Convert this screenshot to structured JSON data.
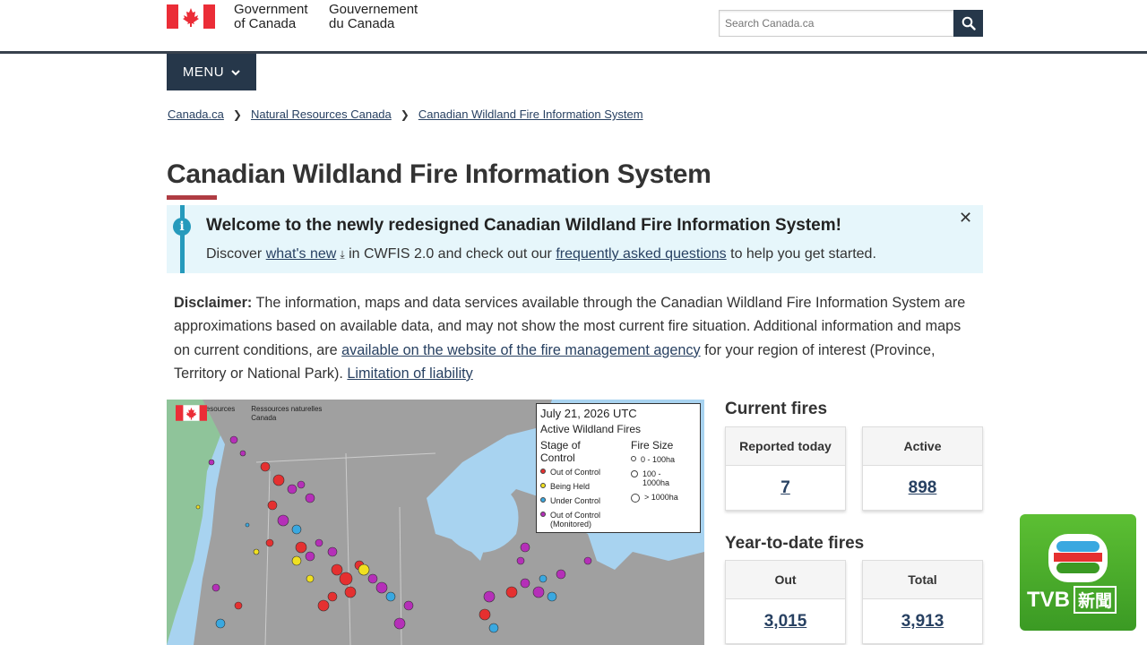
{
  "header": {
    "gov_en_line1": "Government",
    "gov_en_line2": "of Canada",
    "gov_fr_line1": "Gouvernement",
    "gov_fr_line2": "du Canada",
    "search_placeholder": "Search Canada.ca"
  },
  "menu": {
    "label": "MENU"
  },
  "breadcrumb": [
    "Canada.ca",
    "Natural Resources Canada",
    "Canadian Wildland Fire Information System"
  ],
  "page_title": "Canadian Wildland Fire Information System",
  "alert": {
    "heading": "Welcome to the newly redesigned Canadian Wildland Fire Information System!",
    "body_1": "Discover ",
    "link_1": "what's new",
    "body_2": " in CWFIS 2.0 and check out our ",
    "link_2": "frequently asked questions",
    "body_3": " to help you get started."
  },
  "disclaimer": {
    "label": "Disclaimer:",
    "text_1": " The information, maps and data services available through the Canadian Wildland Fire Information System are approximations based on available data, and may not show the most current fire situation. Additional information and maps on current conditions, are ",
    "link_1": "available on the website of the fire management agency",
    "text_2": " for your region of interest (Province, Territory or National Park). ",
    "link_2": "Limitation of liability"
  },
  "map": {
    "logo_en_1": "Natural Resources",
    "logo_en_2": "Canada",
    "logo_fr_1": "Ressources naturelles",
    "logo_fr_2": "Canada",
    "legend": {
      "date": "July 21, 2026 UTC",
      "subtitle": "Active Wildland Fires",
      "stage_heading_1": "Stage of",
      "stage_heading_2": "Control",
      "size_heading": "Fire Size",
      "stages": [
        {
          "label": "Out of Control",
          "color": "#e53030"
        },
        {
          "label": "Being Held",
          "color": "#f0e020"
        },
        {
          "label": "Under Control",
          "color": "#3aa8e0"
        },
        {
          "label": "Out of Control",
          "label_2": "(Monitored)",
          "color": "#b52fb8"
        }
      ],
      "sizes": [
        "0 - 100ha",
        "100 -",
        "1000ha",
        "> 1000ha"
      ]
    }
  },
  "current_fires": {
    "heading": "Current fires",
    "reported_today_label": "Reported today",
    "reported_today_value": "7",
    "active_label": "Active",
    "active_value": "898"
  },
  "ytd_fires": {
    "heading": "Year-to-date fires",
    "out_label": "Out",
    "out_value": "3,015",
    "total_label": "Total",
    "total_value": "3,913"
  },
  "watermark": {
    "text": "TVB",
    "text_2": "新聞"
  }
}
